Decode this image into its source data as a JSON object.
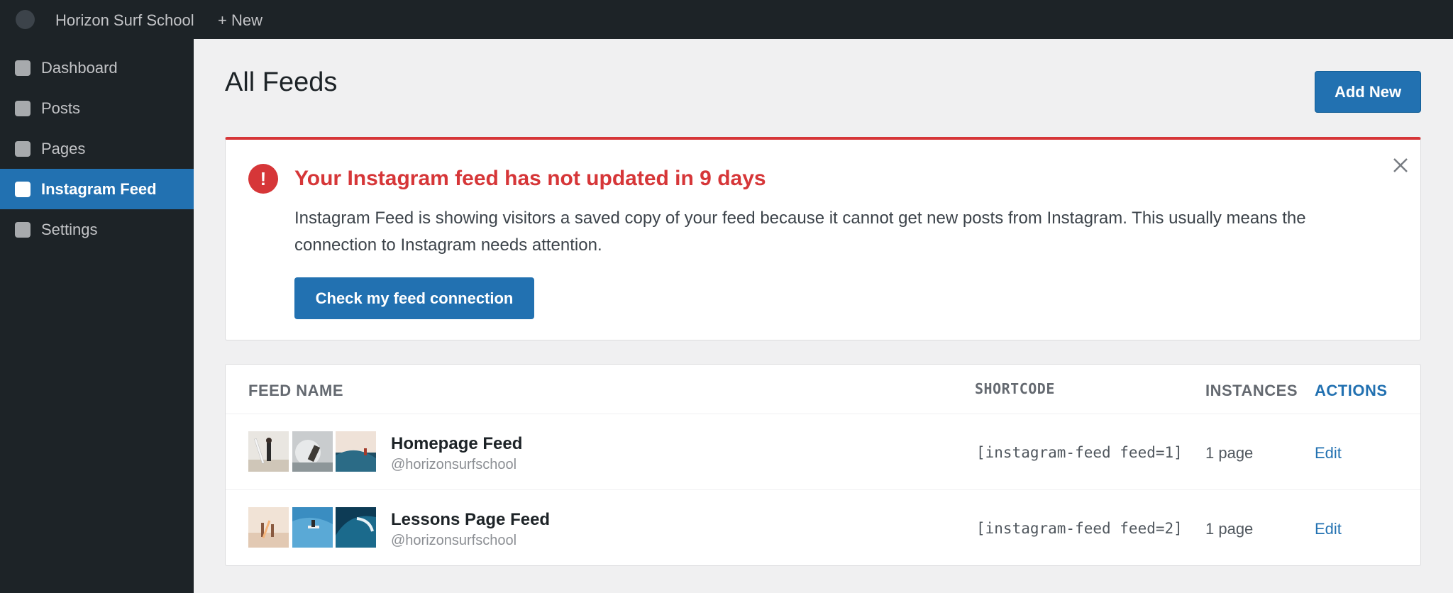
{
  "topbar": {
    "site_name": "Horizon Surf School",
    "new_label": "+ New",
    "logo_icon": "wordpress-logo-icon"
  },
  "sidebar": {
    "items": [
      {
        "label": "Dashboard",
        "icon": "dashboard-icon",
        "active": false
      },
      {
        "label": "Posts",
        "icon": "posts-icon",
        "active": false
      },
      {
        "label": "Pages",
        "icon": "pages-icon",
        "active": false
      },
      {
        "label": "Instagram Feed",
        "icon": "instagram-icon",
        "active": true
      },
      {
        "label": "Settings",
        "icon": "settings-icon",
        "active": false
      }
    ]
  },
  "header": {
    "title": "All Feeds",
    "add_new_label": "Add New"
  },
  "notice": {
    "icon": "exclamation-icon",
    "title": "Your Instagram feed has not updated in 9 days",
    "body": "Instagram Feed is showing visitors a saved copy of your feed because it cannot get new posts from Instagram. This usually means the connection to Instagram needs attention.",
    "button_label": "Check my feed connection",
    "close_icon": "close-icon"
  },
  "table": {
    "columns": {
      "feed_name": "FEED NAME",
      "shortcode": "SHORTCODE",
      "instances": "INSTANCES",
      "actions": "ACTIONS"
    },
    "rows": [
      {
        "name": "Homepage Feed",
        "handle": "@horizonsurfschool",
        "shortcode": "[instagram-feed feed=1]",
        "instances": "1 page",
        "action": "Edit",
        "thumbnails": [
          "surfer-on-beach-thumbnail",
          "surfer-in-spray-thumbnail",
          "surfer-on-wave-thumbnail"
        ]
      },
      {
        "name": "Lessons Page Feed",
        "handle": "@horizonsurfschool",
        "shortcode": "[instagram-feed feed=2]",
        "instances": "1 page",
        "action": "Edit",
        "thumbnails": [
          "surfers-at-shore-thumbnail",
          "surf-lesson-water-thumbnail",
          "barrel-wave-thumbnail"
        ]
      }
    ]
  },
  "colors": {
    "admin_bar": "#1d2327",
    "accent": "#2271b1",
    "error": "#d63638",
    "background": "#f0f0f1"
  }
}
